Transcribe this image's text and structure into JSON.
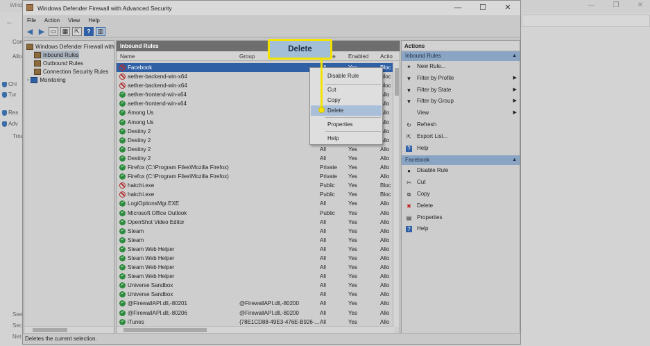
{
  "background": {
    "title": "Wind",
    "side_items": [
      "Con",
      "Allo",
      "Chi",
      "Tur",
      "Res",
      "Adv",
      "Trou"
    ],
    "bottom_items": [
      "See",
      "Sec",
      "Net"
    ]
  },
  "window": {
    "title": "Windows Defender Firewall with Advanced Security",
    "minimize": "—",
    "maximize": "☐",
    "close": "✕"
  },
  "menu": [
    "File",
    "Action",
    "View",
    "Help"
  ],
  "toolbar": {
    "help_label": "?"
  },
  "tree": {
    "root": "Windows Defender Firewall with",
    "items": [
      "Inbound Rules",
      "Outbound Rules",
      "Connection Security Rules",
      "Monitoring"
    ]
  },
  "center": {
    "title": "Inbound Rules",
    "columns": {
      "name": "Name",
      "group": "Group",
      "profile": "Profile",
      "enabled": "Enabled",
      "action": "Actio"
    },
    "rows": [
      {
        "icon": "block",
        "name": "Facebook",
        "group": "",
        "profile": "All",
        "enabled": "Yes",
        "action": "Bloc"
      },
      {
        "icon": "block",
        "name": "aether-backend-win-x64",
        "group": "",
        "profile": "All",
        "enabled": "Yes",
        "action": "Bloc"
      },
      {
        "icon": "block",
        "name": "aether-backend-win-x64",
        "group": "",
        "profile": "All",
        "enabled": "Yes",
        "action": "Bloc"
      },
      {
        "icon": "allow",
        "name": "aether-frontend-win-x64",
        "group": "",
        "profile": "All",
        "enabled": "Yes",
        "action": "Allo"
      },
      {
        "icon": "allow",
        "name": "aether-frontend-win-x64",
        "group": "",
        "profile": "All",
        "enabled": "Yes",
        "action": "Allo"
      },
      {
        "icon": "allow",
        "name": "Among Us",
        "group": "",
        "profile": "All",
        "enabled": "Yes",
        "action": "Allo"
      },
      {
        "icon": "allow",
        "name": "Among Us",
        "group": "",
        "profile": "All",
        "enabled": "Yes",
        "action": "Allo"
      },
      {
        "icon": "allow",
        "name": "Destiny 2",
        "group": "",
        "profile": "All",
        "enabled": "Yes",
        "action": "Allo"
      },
      {
        "icon": "allow",
        "name": "Destiny 2",
        "group": "",
        "profile": "All",
        "enabled": "Yes",
        "action": "Allo"
      },
      {
        "icon": "allow",
        "name": "Destiny 2",
        "group": "",
        "profile": "All",
        "enabled": "Yes",
        "action": "Allo"
      },
      {
        "icon": "allow",
        "name": "Destiny 2",
        "group": "",
        "profile": "All",
        "enabled": "Yes",
        "action": "Allo"
      },
      {
        "icon": "allow",
        "name": "Firefox (C:\\Program Files\\Mozilla Firefox)",
        "group": "",
        "profile": "Private",
        "enabled": "Yes",
        "action": "Allo"
      },
      {
        "icon": "allow",
        "name": "Firefox (C:\\Program Files\\Mozilla Firefox)",
        "group": "",
        "profile": "Private",
        "enabled": "Yes",
        "action": "Allo"
      },
      {
        "icon": "block",
        "name": "hakchi.exe",
        "group": "",
        "profile": "Public",
        "enabled": "Yes",
        "action": "Bloc"
      },
      {
        "icon": "block",
        "name": "hakchi.exe",
        "group": "",
        "profile": "Public",
        "enabled": "Yes",
        "action": "Bloc"
      },
      {
        "icon": "allow",
        "name": "LogiOptionsMgr.EXE",
        "group": "",
        "profile": "All",
        "enabled": "Yes",
        "action": "Allo"
      },
      {
        "icon": "allow",
        "name": "Microsoft Office Outlook",
        "group": "",
        "profile": "Public",
        "enabled": "Yes",
        "action": "Allo"
      },
      {
        "icon": "allow",
        "name": "OpenShot Video Editor",
        "group": "",
        "profile": "All",
        "enabled": "Yes",
        "action": "Allo"
      },
      {
        "icon": "allow",
        "name": "Steam",
        "group": "",
        "profile": "All",
        "enabled": "Yes",
        "action": "Allo"
      },
      {
        "icon": "allow",
        "name": "Steam",
        "group": "",
        "profile": "All",
        "enabled": "Yes",
        "action": "Allo"
      },
      {
        "icon": "allow",
        "name": "Steam Web Helper",
        "group": "",
        "profile": "All",
        "enabled": "Yes",
        "action": "Allo"
      },
      {
        "icon": "allow",
        "name": "Steam Web Helper",
        "group": "",
        "profile": "All",
        "enabled": "Yes",
        "action": "Allo"
      },
      {
        "icon": "allow",
        "name": "Steam Web Helper",
        "group": "",
        "profile": "All",
        "enabled": "Yes",
        "action": "Allo"
      },
      {
        "icon": "allow",
        "name": "Steam Web Helper",
        "group": "",
        "profile": "All",
        "enabled": "Yes",
        "action": "Allo"
      },
      {
        "icon": "allow",
        "name": "Universe Sandbox",
        "group": "",
        "profile": "All",
        "enabled": "Yes",
        "action": "Allo"
      },
      {
        "icon": "allow",
        "name": "Universe Sandbox",
        "group": "",
        "profile": "All",
        "enabled": "Yes",
        "action": "Allo"
      },
      {
        "icon": "allow",
        "name": "@FirewallAPI.dll,-80201",
        "group": "@FirewallAPI.dll,-80200",
        "profile": "All",
        "enabled": "Yes",
        "action": "Allo"
      },
      {
        "icon": "allow",
        "name": "@FirewallAPI.dll,-80206",
        "group": "@FirewallAPI.dll,-80200",
        "profile": "All",
        "enabled": "Yes",
        "action": "Allo"
      },
      {
        "icon": "allow",
        "name": "iTunes",
        "group": "{78E1CD88-49E3-476E-B926-...",
        "profile": "All",
        "enabled": "Yes",
        "action": "Allo"
      }
    ]
  },
  "actions": {
    "title": "Actions",
    "section1": "Inbound Rules",
    "items1": [
      {
        "label": "New Rule...",
        "icon": "✦",
        "submenu": false
      },
      {
        "label": "Filter by Profile",
        "icon": "▼",
        "submenu": true
      },
      {
        "label": "Filter by State",
        "icon": "▼",
        "submenu": true
      },
      {
        "label": "Filter by Group",
        "icon": "▼",
        "submenu": true
      },
      {
        "label": "View",
        "icon": "",
        "submenu": true
      },
      {
        "label": "Refresh",
        "icon": "↻",
        "submenu": false
      },
      {
        "label": "Export List...",
        "icon": "⇱",
        "submenu": false
      },
      {
        "label": "Help",
        "icon": "?",
        "submenu": false
      }
    ],
    "section2": "Facebook",
    "items2": [
      {
        "label": "Disable Rule",
        "icon": "●"
      },
      {
        "label": "Cut",
        "icon": "✂"
      },
      {
        "label": "Copy",
        "icon": "⧉"
      },
      {
        "label": "Delete",
        "icon": "✖"
      },
      {
        "label": "Properties",
        "icon": "▤"
      },
      {
        "label": "Help",
        "icon": "?"
      }
    ]
  },
  "context_menu": {
    "items": [
      "Disable Rule",
      "Cut",
      "Copy",
      "Delete",
      "Properties",
      "Help"
    ],
    "highlighted": "Delete"
  },
  "callout": {
    "label": "Delete"
  },
  "status": "Deletes the current selection.",
  "colors": {
    "selection": "#2f5fa5",
    "callout_border": "#f3e300",
    "allow": "#2e8b3e",
    "block": "#b03030"
  }
}
